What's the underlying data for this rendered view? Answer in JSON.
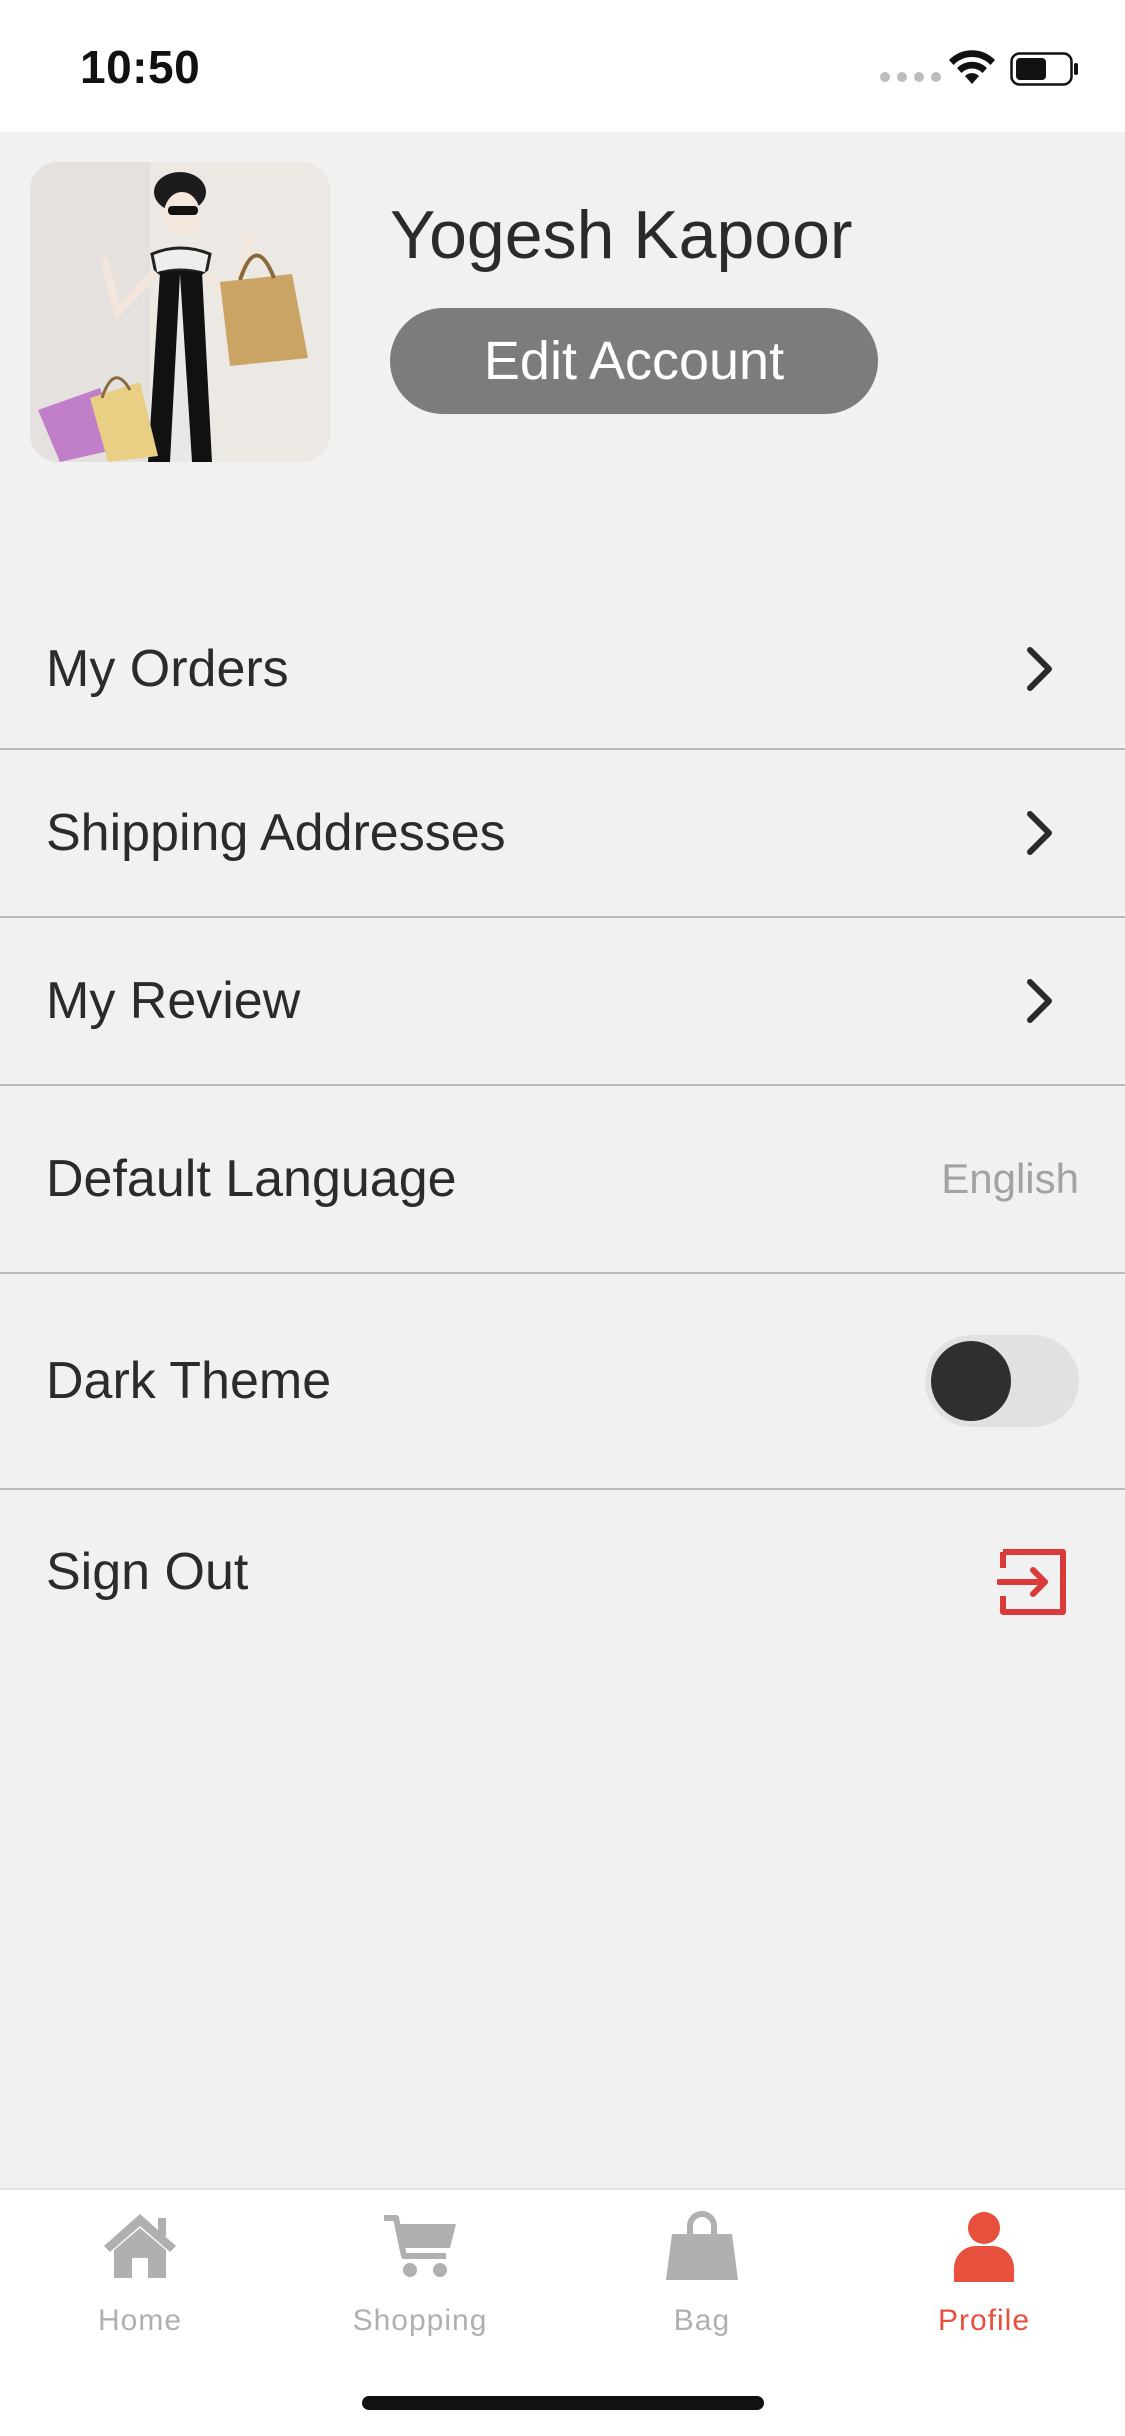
{
  "status_bar": {
    "time": "10:50"
  },
  "profile": {
    "name": "Yogesh Kapoor",
    "edit_button_label": "Edit Account"
  },
  "menu": {
    "my_orders": "My Orders",
    "shipping_addresses": "Shipping Addresses",
    "my_review": "My Review",
    "default_language": {
      "label": "Default Language",
      "value": "English"
    },
    "dark_theme": {
      "label": "Dark Theme",
      "enabled": false
    },
    "sign_out": "Sign Out"
  },
  "tab_bar": {
    "tabs": [
      {
        "label": "Home",
        "icon": "home-icon",
        "active": false
      },
      {
        "label": "Shopping",
        "icon": "cart-icon",
        "active": false
      },
      {
        "label": "Bag",
        "icon": "bag-icon",
        "active": false
      },
      {
        "label": "Profile",
        "icon": "profile-icon",
        "active": true
      }
    ]
  },
  "colors": {
    "background": "#f1f1f1",
    "accent": "#e84f3c",
    "signout_icon": "#d93a3a",
    "edit_button": "#7c7c7c",
    "inactive_tab": "#b0b0b0"
  }
}
